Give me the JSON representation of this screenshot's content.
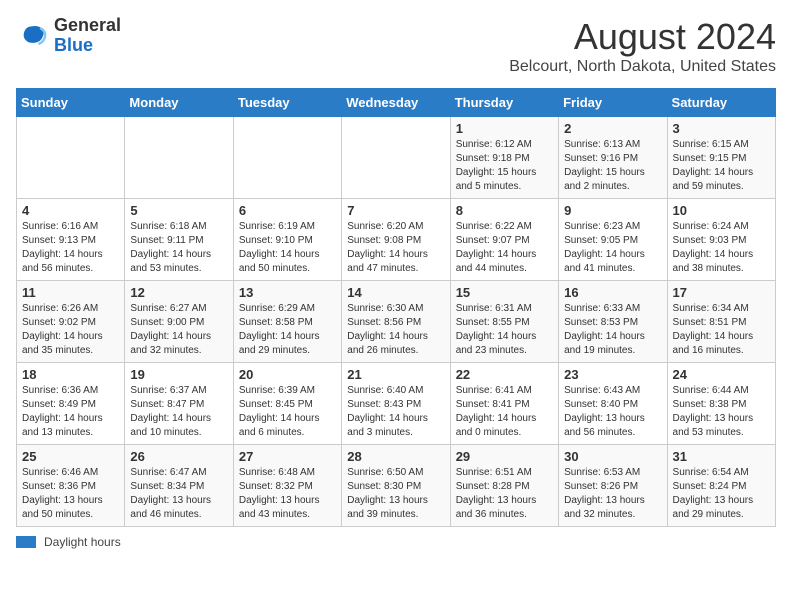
{
  "header": {
    "logo_general": "General",
    "logo_blue": "Blue",
    "month_year": "August 2024",
    "location": "Belcourt, North Dakota, United States"
  },
  "days_of_week": [
    "Sunday",
    "Monday",
    "Tuesday",
    "Wednesday",
    "Thursday",
    "Friday",
    "Saturday"
  ],
  "weeks": [
    [
      {
        "day": "",
        "info": ""
      },
      {
        "day": "",
        "info": ""
      },
      {
        "day": "",
        "info": ""
      },
      {
        "day": "",
        "info": ""
      },
      {
        "day": "1",
        "info": "Sunrise: 6:12 AM\nSunset: 9:18 PM\nDaylight: 15 hours\nand 5 minutes."
      },
      {
        "day": "2",
        "info": "Sunrise: 6:13 AM\nSunset: 9:16 PM\nDaylight: 15 hours\nand 2 minutes."
      },
      {
        "day": "3",
        "info": "Sunrise: 6:15 AM\nSunset: 9:15 PM\nDaylight: 14 hours\nand 59 minutes."
      }
    ],
    [
      {
        "day": "4",
        "info": "Sunrise: 6:16 AM\nSunset: 9:13 PM\nDaylight: 14 hours\nand 56 minutes."
      },
      {
        "day": "5",
        "info": "Sunrise: 6:18 AM\nSunset: 9:11 PM\nDaylight: 14 hours\nand 53 minutes."
      },
      {
        "day": "6",
        "info": "Sunrise: 6:19 AM\nSunset: 9:10 PM\nDaylight: 14 hours\nand 50 minutes."
      },
      {
        "day": "7",
        "info": "Sunrise: 6:20 AM\nSunset: 9:08 PM\nDaylight: 14 hours\nand 47 minutes."
      },
      {
        "day": "8",
        "info": "Sunrise: 6:22 AM\nSunset: 9:07 PM\nDaylight: 14 hours\nand 44 minutes."
      },
      {
        "day": "9",
        "info": "Sunrise: 6:23 AM\nSunset: 9:05 PM\nDaylight: 14 hours\nand 41 minutes."
      },
      {
        "day": "10",
        "info": "Sunrise: 6:24 AM\nSunset: 9:03 PM\nDaylight: 14 hours\nand 38 minutes."
      }
    ],
    [
      {
        "day": "11",
        "info": "Sunrise: 6:26 AM\nSunset: 9:02 PM\nDaylight: 14 hours\nand 35 minutes."
      },
      {
        "day": "12",
        "info": "Sunrise: 6:27 AM\nSunset: 9:00 PM\nDaylight: 14 hours\nand 32 minutes."
      },
      {
        "day": "13",
        "info": "Sunrise: 6:29 AM\nSunset: 8:58 PM\nDaylight: 14 hours\nand 29 minutes."
      },
      {
        "day": "14",
        "info": "Sunrise: 6:30 AM\nSunset: 8:56 PM\nDaylight: 14 hours\nand 26 minutes."
      },
      {
        "day": "15",
        "info": "Sunrise: 6:31 AM\nSunset: 8:55 PM\nDaylight: 14 hours\nand 23 minutes."
      },
      {
        "day": "16",
        "info": "Sunrise: 6:33 AM\nSunset: 8:53 PM\nDaylight: 14 hours\nand 19 minutes."
      },
      {
        "day": "17",
        "info": "Sunrise: 6:34 AM\nSunset: 8:51 PM\nDaylight: 14 hours\nand 16 minutes."
      }
    ],
    [
      {
        "day": "18",
        "info": "Sunrise: 6:36 AM\nSunset: 8:49 PM\nDaylight: 14 hours\nand 13 minutes."
      },
      {
        "day": "19",
        "info": "Sunrise: 6:37 AM\nSunset: 8:47 PM\nDaylight: 14 hours\nand 10 minutes."
      },
      {
        "day": "20",
        "info": "Sunrise: 6:39 AM\nSunset: 8:45 PM\nDaylight: 14 hours\nand 6 minutes."
      },
      {
        "day": "21",
        "info": "Sunrise: 6:40 AM\nSunset: 8:43 PM\nDaylight: 14 hours\nand 3 minutes."
      },
      {
        "day": "22",
        "info": "Sunrise: 6:41 AM\nSunset: 8:41 PM\nDaylight: 14 hours\nand 0 minutes."
      },
      {
        "day": "23",
        "info": "Sunrise: 6:43 AM\nSunset: 8:40 PM\nDaylight: 13 hours\nand 56 minutes."
      },
      {
        "day": "24",
        "info": "Sunrise: 6:44 AM\nSunset: 8:38 PM\nDaylight: 13 hours\nand 53 minutes."
      }
    ],
    [
      {
        "day": "25",
        "info": "Sunrise: 6:46 AM\nSunset: 8:36 PM\nDaylight: 13 hours\nand 50 minutes."
      },
      {
        "day": "26",
        "info": "Sunrise: 6:47 AM\nSunset: 8:34 PM\nDaylight: 13 hours\nand 46 minutes."
      },
      {
        "day": "27",
        "info": "Sunrise: 6:48 AM\nSunset: 8:32 PM\nDaylight: 13 hours\nand 43 minutes."
      },
      {
        "day": "28",
        "info": "Sunrise: 6:50 AM\nSunset: 8:30 PM\nDaylight: 13 hours\nand 39 minutes."
      },
      {
        "day": "29",
        "info": "Sunrise: 6:51 AM\nSunset: 8:28 PM\nDaylight: 13 hours\nand 36 minutes."
      },
      {
        "day": "30",
        "info": "Sunrise: 6:53 AM\nSunset: 8:26 PM\nDaylight: 13 hours\nand 32 minutes."
      },
      {
        "day": "31",
        "info": "Sunrise: 6:54 AM\nSunset: 8:24 PM\nDaylight: 13 hours\nand 29 minutes."
      }
    ]
  ],
  "footer": {
    "legend_label": "Daylight hours"
  }
}
